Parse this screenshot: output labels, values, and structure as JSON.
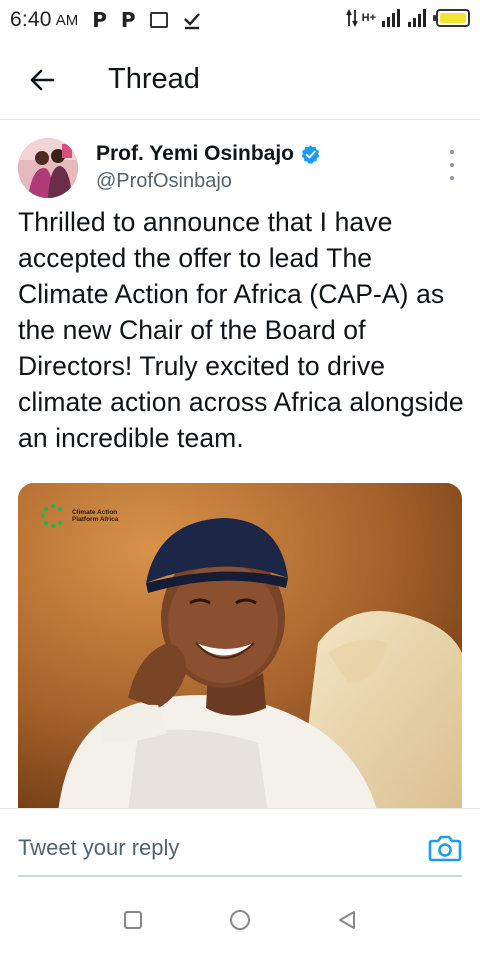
{
  "status_bar": {
    "time": "6:40",
    "ampm": "AM",
    "left_icons": [
      "p-icon",
      "p-icon",
      "notification-box-icon",
      "check-download-icon"
    ],
    "network_label": "H+",
    "battery_color": "#f3e533"
  },
  "header": {
    "title": "Thread",
    "back_icon": "arrow-left-icon"
  },
  "tweet": {
    "author_name": "Prof. Yemi Osinbajo",
    "author_handle": "@ProfOsinbajo",
    "verified_color": "#1d9bf0",
    "text": "Thrilled to announce that I have accepted the offer to lead The Climate Action for Africa (CAP-A) as the new Chair of the Board of Directors! Truly excited to drive climate action across Africa alongside an incredible team.",
    "media": {
      "logo_text_line1": "Climate Action",
      "logo_text_line2": "Platform Africa",
      "logo_color": "#2bb24c"
    }
  },
  "reply": {
    "placeholder": "Tweet your reply",
    "camera_icon": "camera-icon",
    "accent": "#1d9bf0"
  },
  "nav": {
    "buttons": [
      "recent-apps-icon",
      "home-icon",
      "back-triangle-icon"
    ]
  }
}
